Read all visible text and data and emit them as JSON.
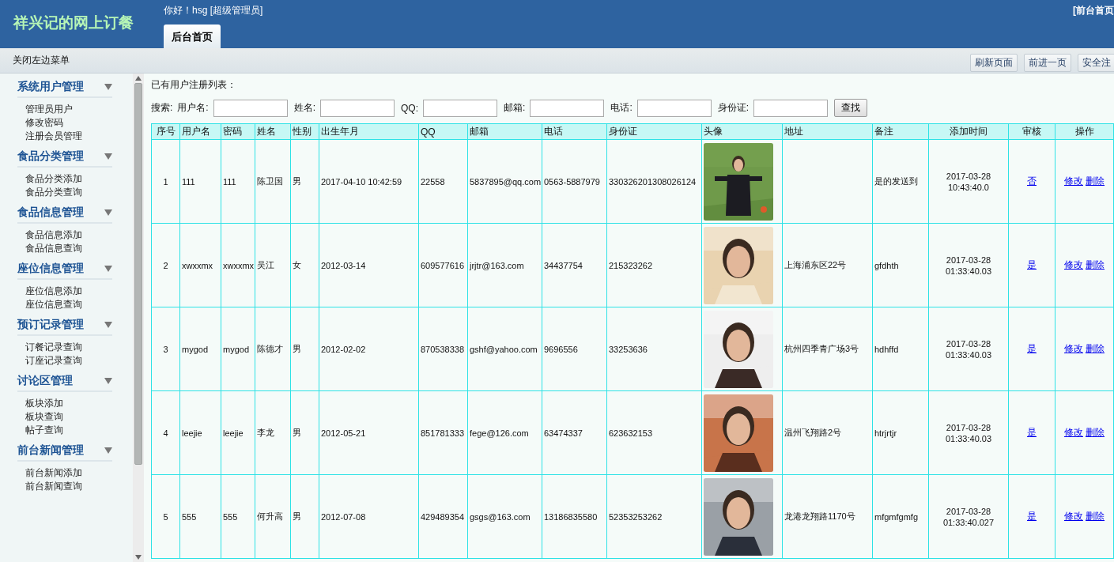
{
  "header": {
    "title": "祥兴记的网上订餐",
    "greeting": "你好！hsg [超级管理员]",
    "top_link": "[前台首页",
    "tabs": [
      {
        "label": "后台首页",
        "selected": true
      }
    ]
  },
  "toolbar": {
    "toggle": "关闭左边菜单",
    "buttons": [
      "刷新页面",
      "前进一页",
      "安全注"
    ]
  },
  "sidebar": [
    {
      "title": "系统用户管理",
      "items": [
        "管理员用户",
        "修改密码",
        "注册会员管理"
      ]
    },
    {
      "title": "食品分类管理",
      "items": [
        "食品分类添加",
        "食品分类查询"
      ]
    },
    {
      "title": "食品信息管理",
      "items": [
        "食品信息添加",
        "食品信息查询"
      ]
    },
    {
      "title": "座位信息管理",
      "items": [
        "座位信息添加",
        "座位信息查询"
      ]
    },
    {
      "title": "预订记录管理",
      "items": [
        "订餐记录查询",
        "订座记录查询"
      ]
    },
    {
      "title": "讨论区管理",
      "items": [
        "板块添加",
        "板块查询",
        "帖子查询"
      ]
    },
    {
      "title": "前台新闻管理",
      "items": [
        "前台新闻添加",
        "前台新闻查询"
      ]
    }
  ],
  "content": {
    "heading": "已有用户注册列表：",
    "search": {
      "label": "搜索:",
      "fields": [
        {
          "label": "用户名:"
        },
        {
          "label": "姓名:"
        },
        {
          "label": "QQ:"
        },
        {
          "label": "邮箱:"
        },
        {
          "label": "电话:"
        },
        {
          "label": "身份证:"
        }
      ],
      "button": "查找"
    },
    "table": {
      "columns": [
        "序号",
        "用户名",
        "密码",
        "姓名",
        "性别",
        "出生年月",
        "QQ",
        "邮箱",
        "电话",
        "身份证",
        "头像",
        "地址",
        "备注",
        "添加时间",
        "审核",
        "操作"
      ],
      "rows": [
        {
          "cells": [
            "1",
            "111",
            "111",
            "陈卫国",
            "男",
            "2017-04-10 10:42:59",
            "22558",
            "5837895@qq.com",
            "0563-5887979",
            "330326201308026124"
          ],
          "photo": {
            "kind": "picture"
          },
          "address": "",
          "note": "是的发送到",
          "added": [
            "2017-03-28",
            "10:43:40.0"
          ],
          "audit": "否",
          "actions": [
            "修改",
            "删除"
          ]
        },
        {
          "cells": [
            "2",
            "xwxxmx",
            "xwxxmx",
            "吴江",
            "女",
            "2012-03-14",
            "609577616",
            "jrjtr@163.com",
            "34437754",
            "215323262"
          ],
          "photo": {
            "kind": "picture"
          },
          "address": "上海浦东区22号",
          "note": "gfdhth",
          "added": [
            "2017-03-28",
            "01:33:40.03"
          ],
          "audit": "是",
          "actions": [
            "修改",
            "删除"
          ]
        },
        {
          "cells": [
            "3",
            "mygod",
            "mygod",
            "陈德才",
            "男",
            "2012-02-02",
            "870538338",
            "gshf@yahoo.com",
            "9696556",
            "33253636"
          ],
          "photo": {
            "kind": "picture"
          },
          "address": "杭州四季青广场3号",
          "note": "hdhffd",
          "added": [
            "2017-03-28",
            "01:33:40.03"
          ],
          "audit": "是",
          "actions": [
            "修改",
            "删除"
          ]
        },
        {
          "cells": [
            "4",
            "leejie",
            "leejie",
            "李龙",
            "男",
            "2012-05-21",
            "851781333",
            "fege@126.com",
            "63474337",
            "623632153"
          ],
          "photo": {
            "kind": "picture"
          },
          "address": "温州飞翔路2号",
          "note": "htrjrtjr",
          "added": [
            "2017-03-28",
            "01:33:40.03"
          ],
          "audit": "是",
          "actions": [
            "修改",
            "删除"
          ]
        },
        {
          "cells": [
            "5",
            "555",
            "555",
            "何升高",
            "男",
            "2012-07-08",
            "429489354",
            "gsgs@163.com",
            "13186835580",
            "52353253262"
          ],
          "photo": {
            "kind": "picture"
          },
          "address": "龙港龙翔路1170号",
          "note": "mfgmfgmfg",
          "added": [
            "2017-03-28",
            "01:33:40.027"
          ],
          "audit": "是",
          "actions": [
            "修改",
            "删除"
          ]
        }
      ]
    }
  }
}
